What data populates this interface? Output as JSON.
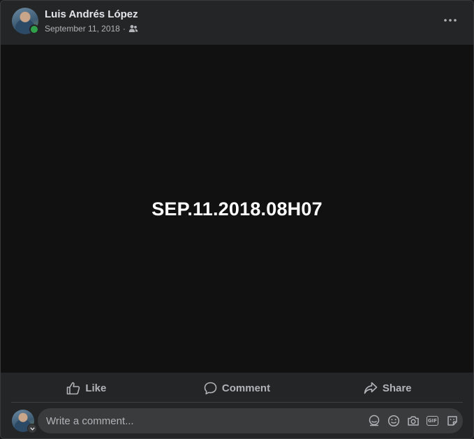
{
  "post": {
    "author_name": "Luis Andrés López",
    "date": "September 11, 2018",
    "separator": "·",
    "audience_icon": "friends-icon",
    "media_text": "SEP.11.2018.08H07"
  },
  "actions": {
    "like_label": "Like",
    "comment_label": "Comment",
    "share_label": "Share"
  },
  "comment": {
    "placeholder": "Write a comment...",
    "tool_icons": [
      "avatar-sticker-icon",
      "emoji-icon",
      "camera-icon",
      "gif-icon",
      "sticker-icon"
    ],
    "gif_text": "GIF"
  },
  "colors": {
    "background": "#242526",
    "media_background": "#111111",
    "online": "#31a24c",
    "secondary_text": "#b0b3b8",
    "primary_text": "#e4e6eb"
  }
}
